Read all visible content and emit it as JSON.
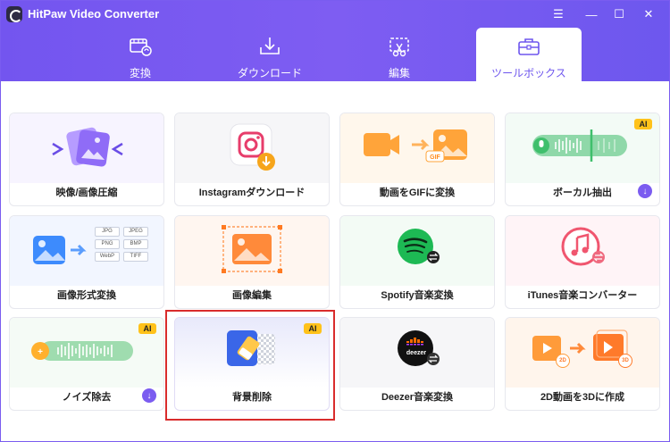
{
  "window": {
    "title": "HitPaw Video Converter",
    "controls": {
      "menu": "☰",
      "minimize": "—",
      "maximize": "☐",
      "close": "✕"
    }
  },
  "tabs": [
    {
      "label": "変換",
      "icon": "film-convert-icon",
      "active": false
    },
    {
      "label": "ダウンロード",
      "icon": "download-tray-icon",
      "active": false
    },
    {
      "label": "編集",
      "icon": "edit-scissors-icon",
      "active": false
    },
    {
      "label": "ツールボックス",
      "icon": "toolbox-icon",
      "active": true
    }
  ],
  "cards": [
    {
      "label": "映像/画像圧縮",
      "icon": "compress-images-icon"
    },
    {
      "label": "Instagramダウンロード",
      "icon": "instagram-icon"
    },
    {
      "label": "動画をGIFに変換",
      "icon": "video-to-gif-icon"
    },
    {
      "label": "ボーカル抽出",
      "icon": "vocal-waveform-icon",
      "badge": "AI",
      "download": true
    },
    {
      "label": "画像形式変換",
      "icon": "image-format-icon",
      "formats": [
        "JPG",
        "JPEG",
        "PNG",
        "BMP",
        "WebP",
        "TIFF"
      ]
    },
    {
      "label": "画像編集",
      "icon": "image-crop-icon"
    },
    {
      "label": "Spotify音楽変換",
      "icon": "spotify-icon"
    },
    {
      "label": "iTunes音楽コンバーター",
      "icon": "itunes-icon"
    },
    {
      "label": "ノイズ除去",
      "icon": "noise-waveform-icon",
      "badge": "AI",
      "download": true
    },
    {
      "label": "背景削除",
      "icon": "background-remove-icon",
      "badge": "AI",
      "selected": true
    },
    {
      "label": "Deezer音楽変換",
      "icon": "deezer-icon",
      "logo_text": "deezer"
    },
    {
      "label": "2D動画を3Dに作成",
      "icon": "2d-to-3d-icon",
      "tags": [
        "2D",
        "3D"
      ]
    }
  ],
  "colors": {
    "accent": "#7355ef",
    "badge": "#ffc21a",
    "selection": "#d92c2c"
  }
}
